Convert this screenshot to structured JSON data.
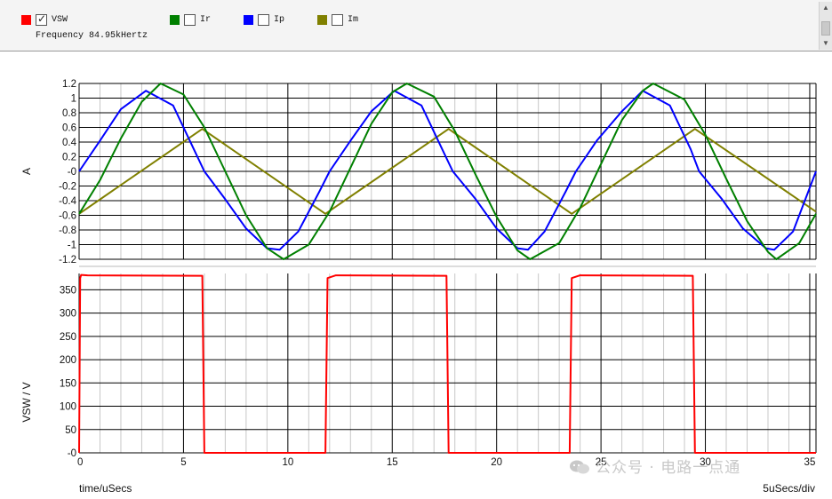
{
  "legend": {
    "items": [
      {
        "label": "VSW",
        "color": "#ff0000",
        "checked": true
      },
      {
        "label": "Ir",
        "color": "#008000",
        "checked": false
      },
      {
        "label": "Ip",
        "color": "#0000ff",
        "checked": false
      },
      {
        "label": "Im",
        "color": "#808000",
        "checked": false
      }
    ],
    "frequency": "Frequency 84.95kHertz"
  },
  "watermark": "公众号 · 电路一点通",
  "chart_data": [
    {
      "type": "line",
      "title": "",
      "ylabel": "A",
      "xlim": [
        0,
        35.3
      ],
      "ylim": [
        -1.2,
        1.2
      ],
      "yticks": [
        "1.2",
        "1",
        "0.8",
        "0.6",
        "0.4",
        "0.2",
        "-0",
        "-0.2",
        "-0.4",
        "-0.6",
        "-0.8",
        "-1",
        "-1.2"
      ],
      "grid": true,
      "series": [
        {
          "name": "Ir",
          "color": "#008000",
          "x": [
            0,
            1,
            2,
            3,
            3.9,
            5,
            6,
            7,
            8,
            9,
            9.8,
            11,
            12,
            13,
            14,
            15,
            15.7,
            17,
            18,
            19,
            20,
            21,
            21.6,
            23,
            24,
            25,
            26,
            27,
            27.5,
            29,
            30,
            31,
            32,
            33,
            33.4,
            34.5,
            35.3
          ],
          "y": [
            -0.58,
            -0.12,
            0.45,
            0.95,
            1.2,
            1.05,
            0.6,
            0.0,
            -0.6,
            -1.05,
            -1.2,
            -1.0,
            -0.55,
            0.05,
            0.65,
            1.08,
            1.2,
            1.02,
            0.55,
            -0.05,
            -0.62,
            -1.08,
            -1.2,
            -0.98,
            -0.5,
            0.1,
            0.7,
            1.1,
            1.2,
            0.98,
            0.5,
            -0.1,
            -0.68,
            -1.1,
            -1.2,
            -0.98,
            -0.58
          ]
        },
        {
          "name": "Ip",
          "color": "#0000ff",
          "x": [
            0,
            1,
            2,
            3.2,
            4.5,
            5.5,
            6,
            7,
            8,
            9,
            9.6,
            10.5,
            11.5,
            12,
            13,
            14,
            15.1,
            16.4,
            17.4,
            17.9,
            19,
            20,
            21,
            21.5,
            22.3,
            23.3,
            23.8,
            24.8,
            26,
            27,
            28.3,
            29.3,
            29.7,
            30.8,
            31.8,
            32.9,
            33.3,
            34.2,
            35.3
          ],
          "y": [
            0.0,
            0.42,
            0.85,
            1.1,
            0.9,
            0.3,
            0.0,
            -0.38,
            -0.78,
            -1.05,
            -1.07,
            -0.82,
            -0.28,
            0.0,
            0.42,
            0.82,
            1.1,
            0.9,
            0.3,
            0.0,
            -0.38,
            -0.78,
            -1.05,
            -1.07,
            -0.82,
            -0.28,
            0.0,
            0.42,
            0.82,
            1.1,
            0.9,
            0.3,
            0.0,
            -0.38,
            -0.78,
            -1.05,
            -1.07,
            -0.82,
            0.0
          ]
        },
        {
          "name": "Im",
          "color": "#808000",
          "x": [
            0,
            5.9,
            11.8,
            17.7,
            23.6,
            29.5,
            35.3
          ],
          "y": [
            -0.58,
            0.58,
            -0.58,
            0.58,
            -0.58,
            0.58,
            -0.55
          ]
        }
      ]
    },
    {
      "type": "line",
      "title": "",
      "xlabel": "time/uSecs",
      "ylabel": "VSW / V",
      "x_scale_note": "5uSecs/div",
      "xlim": [
        0,
        35.3
      ],
      "ylim": [
        0,
        385
      ],
      "yticks": [
        "350",
        "300",
        "250",
        "200",
        "150",
        "100",
        "50",
        "-0"
      ],
      "xticks": [
        "0",
        "5",
        "10",
        "15",
        "20",
        "25",
        "30",
        "35"
      ],
      "grid": true,
      "series": [
        {
          "name": "VSW",
          "color": "#ff0000",
          "x": [
            0,
            0.05,
            0.1,
            0.4,
            5.9,
            6.0,
            11.8,
            11.9,
            12.3,
            17.6,
            17.7,
            23.5,
            23.6,
            24.0,
            29.4,
            29.5,
            35.3
          ],
          "y": [
            0,
            375,
            382,
            381,
            380,
            0,
            0,
            375,
            381,
            380,
            0,
            0,
            375,
            381,
            380,
            0,
            0
          ]
        }
      ]
    }
  ]
}
